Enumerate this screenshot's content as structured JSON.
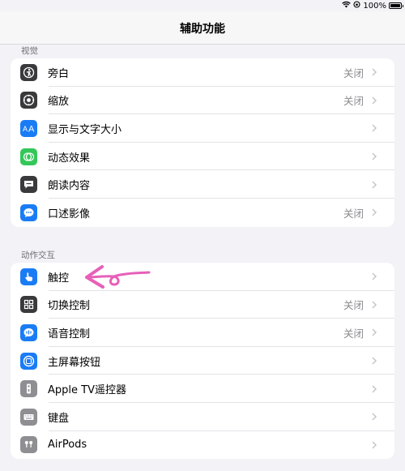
{
  "status_bar": {
    "battery": "100%"
  },
  "nav": {
    "title": "辅助功能"
  },
  "sections": [
    {
      "header": "视觉",
      "items": [
        {
          "label": "旁白",
          "value": "关闭",
          "icon": "voiceover-icon",
          "color": "#3a3a3c"
        },
        {
          "label": "缩放",
          "value": "关闭",
          "icon": "zoom-icon",
          "color": "#3a3a3c"
        },
        {
          "label": "显示与文字大小",
          "value": "",
          "icon": "text-size-icon",
          "color": "#1a7cf5"
        },
        {
          "label": "动态效果",
          "value": "",
          "icon": "motion-icon",
          "color": "#34c759"
        },
        {
          "label": "朗读内容",
          "value": "",
          "icon": "spoken-content-icon",
          "color": "#3a3a3c"
        },
        {
          "label": "口述影像",
          "value": "关闭",
          "icon": "audio-description-icon",
          "color": "#1a7cf5"
        }
      ]
    },
    {
      "header": "动作交互",
      "items": [
        {
          "label": "触控",
          "value": "",
          "icon": "touch-icon",
          "color": "#1a7cf5"
        },
        {
          "label": "切换控制",
          "value": "关闭",
          "icon": "switch-control-icon",
          "color": "#3a3a3c"
        },
        {
          "label": "语音控制",
          "value": "关闭",
          "icon": "voice-control-icon",
          "color": "#1a7cf5"
        },
        {
          "label": "主屏幕按钮",
          "value": "",
          "icon": "home-button-icon",
          "color": "#1a7cf5"
        },
        {
          "label": "Apple TV遥控器",
          "value": "",
          "icon": "apple-tv-remote-icon",
          "color": "#8e8e93"
        },
        {
          "label": "键盘",
          "value": "",
          "icon": "keyboard-icon",
          "color": "#8e8e93"
        },
        {
          "label": "AirPods",
          "value": "",
          "icon": "airpods-icon",
          "color": "#8e8e93"
        }
      ]
    }
  ],
  "annotation": {
    "color": "#e760b9"
  }
}
